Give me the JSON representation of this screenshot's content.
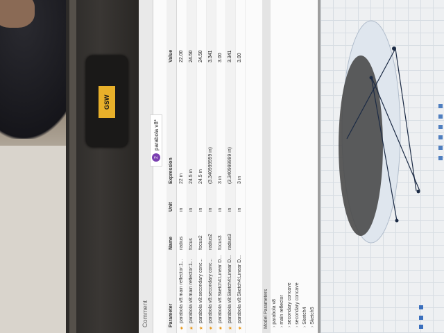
{
  "device": {
    "webcam_logo_text": "GSW"
  },
  "window": {
    "toolbar_label": "Comment",
    "tab_badge": "2",
    "tab_title": "parabola v8*"
  },
  "params_table": {
    "headers": {
      "name": "Name",
      "unit": "Unit",
      "expression": "Expression",
      "value": "Value"
    },
    "rows": [
      {
        "param": "parabola v8:main reflector:1...",
        "name": "radius",
        "unit": "in",
        "expression": "22 in",
        "value": "22.00"
      },
      {
        "param": "parabola v8:main reflector:1...",
        "name": "focus",
        "unit": "in",
        "expression": "24.5 in",
        "value": "24.50"
      },
      {
        "param": "parabola v8:secondary conc...",
        "name": "focus2",
        "unit": "in",
        "expression": "24.5 in",
        "value": "24.50"
      },
      {
        "param": "parabola v8:secondary conc...",
        "name": "radius2",
        "unit": "in",
        "expression": "(3.340999999 in)",
        "value": "3.341"
      },
      {
        "param": "parabola v8:Sketch4:Linear D...",
        "name": "focus3",
        "unit": "in",
        "expression": "3 in",
        "value": "3.00"
      },
      {
        "param": "parabola v8:Sketch4:Linear D...",
        "name": "radius3",
        "unit": "in",
        "expression": "(3.340999999 in)",
        "value": "3.341"
      },
      {
        "param": "parabola v8:Sketch4:Linear D...",
        "name": "",
        "unit": "in",
        "expression": "3 in",
        "value": "3.00"
      }
    ]
  },
  "model_section": {
    "header": "Model Parameters",
    "items": [
      "parabola v8",
      "main reflector",
      "secondary concave",
      "secondary concave",
      "Sketch4",
      "Sketch5",
      "Sketch6",
      "Revolve2",
      "Revolve3",
      "Sketch8"
    ]
  },
  "panel_labels": {
    "left_header": "Parameter",
    "left_sub": "Parameters",
    "favorites": "Favorites"
  },
  "colors": {
    "accent": "#7a3fb0",
    "star": "#e89a20"
  }
}
